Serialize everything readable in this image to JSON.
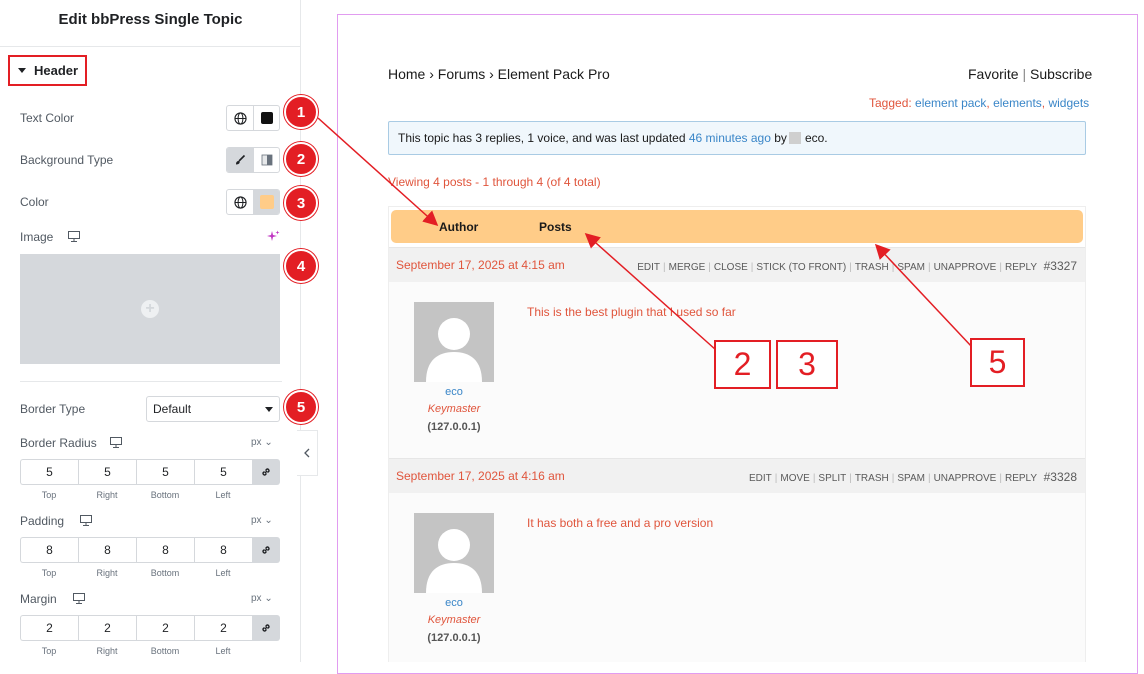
{
  "panel": {
    "title": "Edit bbPress Single Topic",
    "section": "Header",
    "text_color_label": "Text Color",
    "bg_type_label": "Background Type",
    "color_label": "Color",
    "image_label": "Image",
    "border_type_label": "Border Type",
    "border_type_value": "Default",
    "border_radius_label": "Border Radius",
    "padding_label": "Padding",
    "margin_label": "Margin",
    "unit": "px",
    "dim_labels": [
      "Top",
      "Right",
      "Bottom",
      "Left"
    ],
    "border_radius": [
      "5",
      "5",
      "5",
      "5"
    ],
    "padding": [
      "8",
      "8",
      "8",
      "8"
    ],
    "margin": [
      "2",
      "2",
      "2",
      "2"
    ]
  },
  "badges": [
    "1",
    "2",
    "3",
    "4",
    "5"
  ],
  "callouts": [
    "2",
    "3",
    "5"
  ],
  "preview": {
    "breadcrumb": "Home › Forums › Element Pack Pro",
    "favorite": "Favorite",
    "pipe": "|",
    "subscribe": "Subscribe",
    "tagged_label": "Tagged:",
    "tags": [
      "element pack",
      "elements",
      "widgets"
    ],
    "notice_pre": "This topic has 3 replies, 1 voice, and was last updated",
    "notice_time": "46 minutes ago",
    "notice_by": "by",
    "notice_user": "eco.",
    "viewing": "Viewing 4 posts - 1 through 4 (of 4 total)",
    "col_author": "Author",
    "col_posts": "Posts",
    "posts": [
      {
        "date": "September 17, 2025 at 4:15 am",
        "actions": [
          "EDIT",
          "MERGE",
          "CLOSE",
          "STICK (TO FRONT)",
          "TRASH",
          "SPAM",
          "UNAPPROVE",
          "REPLY"
        ],
        "id": "#3327",
        "author": "eco",
        "role": "Keymaster",
        "ip": "(127.0.0.1)",
        "content": "This is the best plugin that I used so far"
      },
      {
        "date": "September 17, 2025 at 4:16 am",
        "actions": [
          "EDIT",
          "MOVE",
          "SPLIT",
          "TRASH",
          "SPAM",
          "UNAPPROVE",
          "REPLY"
        ],
        "id": "#3328",
        "author": "eco",
        "role": "Keymaster",
        "ip": "(127.0.0.1)",
        "content": "It has both a free and a pro version"
      }
    ]
  },
  "colors": {
    "accent": "#e31e24",
    "header_bg": "#ffcc88",
    "link": "#3a86c8",
    "meta": "#e0553c"
  }
}
